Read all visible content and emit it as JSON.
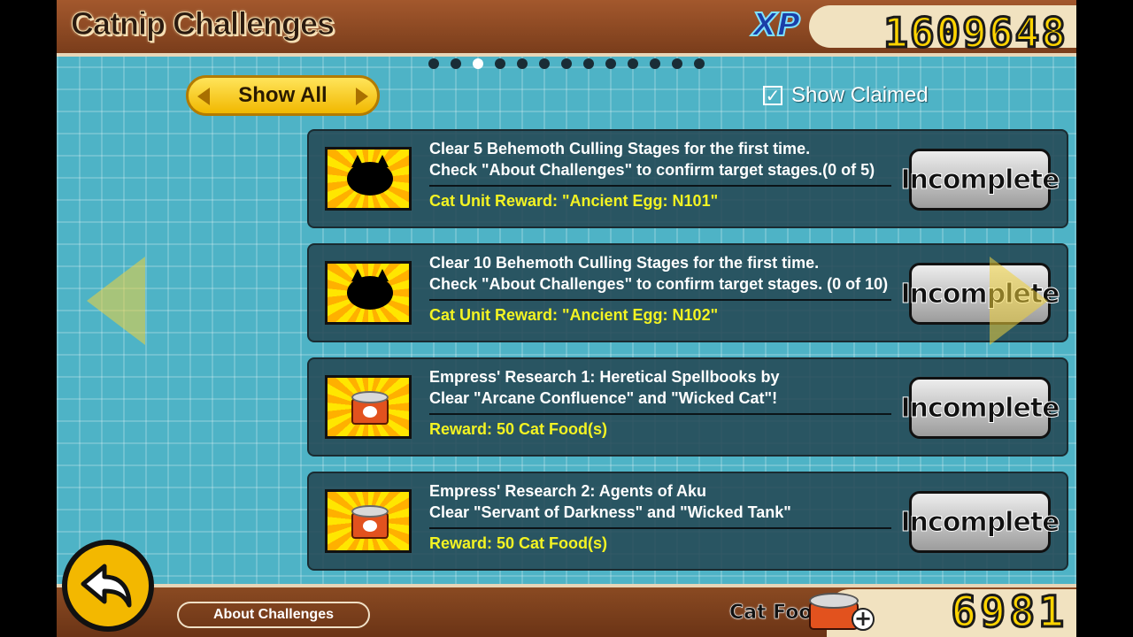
{
  "header": {
    "title": "Catnip Challenges",
    "xp_label": "XP",
    "xp_value": "1609648"
  },
  "pager": {
    "total": 13,
    "active_index": 2
  },
  "filter": {
    "label": "Show All"
  },
  "show_claimed": {
    "label": "Show Claimed",
    "checked": true,
    "check_mark": "✓"
  },
  "challenges": [
    {
      "line1": "Clear 5 Behemoth Culling Stages for the first time.",
      "line2": "Check \"About Challenges\" to confirm target stages.(0 of 5)",
      "reward": "Cat Unit Reward: \"Ancient Egg: N101\"",
      "icon": "cat-silhouette-icon",
      "status": "Incomplete"
    },
    {
      "line1": "Clear 10 Behemoth Culling Stages for the first time.",
      "line2": "Check \"About Challenges\" to confirm target stages. (0 of 10)",
      "reward": "Cat Unit Reward: \"Ancient Egg: N102\"",
      "icon": "cat-silhouette-icon",
      "status": "Incomplete"
    },
    {
      "line1": "Empress' Research 1: Heretical Spellbooks by",
      "line2": "Clear \"Arcane Confluence\" and \"Wicked Cat\"!",
      "reward": "Reward: 50 Cat Food(s)",
      "icon": "cat-food-can-icon",
      "status": "Incomplete"
    },
    {
      "line1": "Empress' Research 2: Agents of Aku",
      "line2": "Clear \"Servant of Darkness\" and \"Wicked Tank\"",
      "reward": "Reward: 50 Cat Food(s)",
      "icon": "cat-food-can-icon",
      "status": "Incomplete"
    }
  ],
  "footer": {
    "about_label": "About Challenges",
    "cat_food_label": "Cat Food",
    "cat_food_value": "6981",
    "plus_symbol": "+"
  },
  "colors": {
    "reward_text": "#f3f323",
    "accent_yellow": "#ffd400",
    "background": "#4eb3c6"
  }
}
